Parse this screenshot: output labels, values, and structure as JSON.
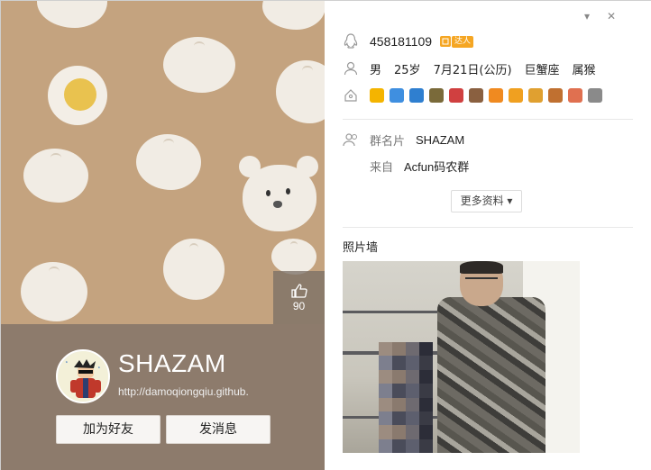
{
  "window": {
    "controls": {
      "menu": "▾",
      "close": "✕"
    }
  },
  "left": {
    "likes": "90",
    "profile": {
      "nickname": "SHAZAM",
      "url": "http://damoqiongqiu.github.",
      "add_friend_label": "加为好友",
      "send_message_label": "发消息"
    }
  },
  "right": {
    "qq_number": "458181109",
    "vip_tag": "达人",
    "basic_info": {
      "gender": "男",
      "age": "25岁",
      "birthday": "7月21日(公历)",
      "zodiac": "巨蟹座",
      "chinese_zodiac": "属猴"
    },
    "badge_colors": [
      "#f4b400",
      "#3f8fe0",
      "#2f7fd0",
      "#7a6a3a",
      "#d04040",
      "#8a6040",
      "#f08a20",
      "#f0a020",
      "#e0a030",
      "#c07030",
      "#e07050",
      "#8a8a8a"
    ],
    "group_card": {
      "label": "群名片",
      "value": "SHAZAM"
    },
    "source": {
      "label": "来自",
      "value": "Acfun码农群"
    },
    "more_button": "更多资料 ▾",
    "photo_wall_title": "照片墙"
  }
}
